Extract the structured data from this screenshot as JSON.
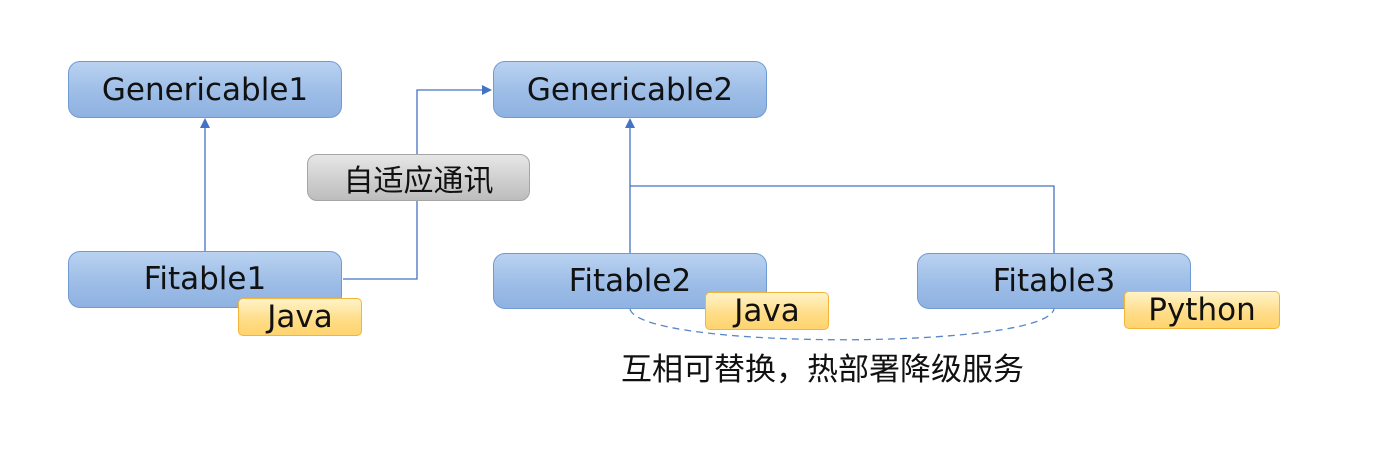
{
  "diagram": {
    "nodes": {
      "genericable1": "Genericable1",
      "genericable2": "Genericable2",
      "fitable1": "Fitable1",
      "fitable2": "Fitable2",
      "fitable3": "Fitable3"
    },
    "tags": {
      "fitable1_lang": "Java",
      "fitable2_lang": "Java",
      "fitable3_lang": "Python"
    },
    "edge_label": "自适应通讯",
    "footnote": "互相可替换，热部署降级服务",
    "colors": {
      "node_fill": "#9dbde7",
      "node_border": "#6f9bd2",
      "tag_fill": "#ffdc85",
      "tag_border": "#f2b53a",
      "label_fill": "#cdcdcd",
      "connector": "#4472c4"
    }
  }
}
